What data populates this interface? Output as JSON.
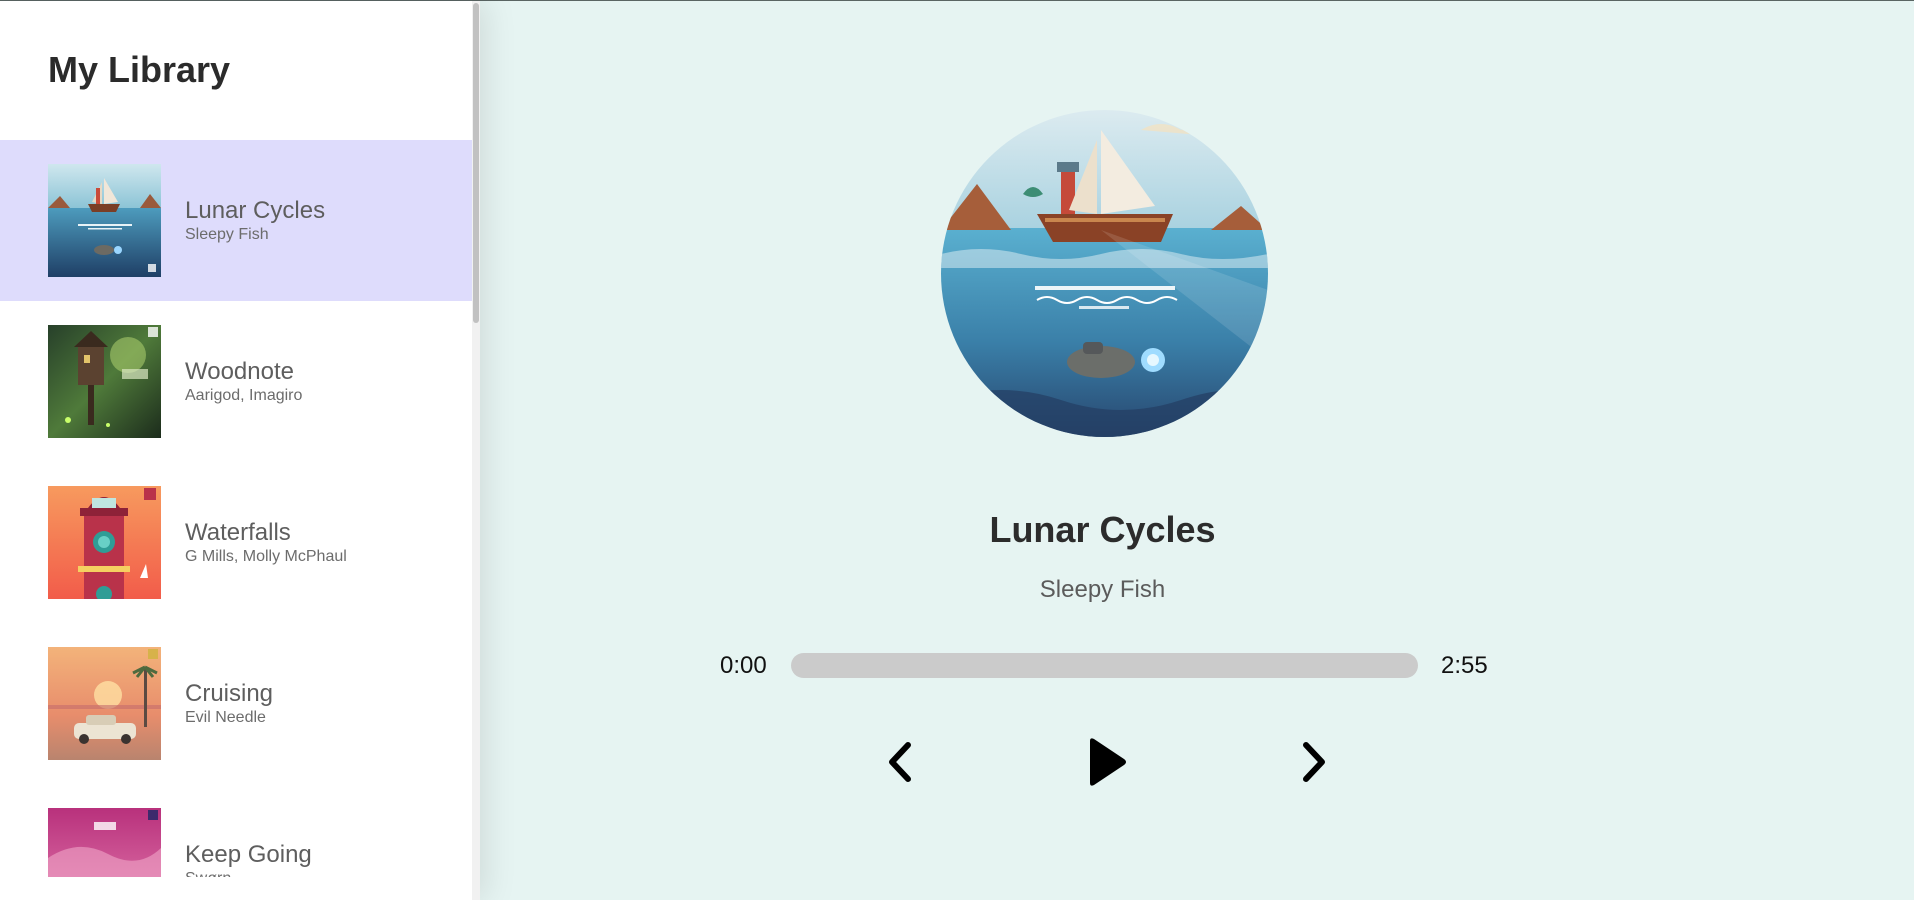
{
  "library": {
    "title": "My Library",
    "songs": [
      {
        "name": "Lunar Cycles",
        "artist": "Sleepy Fish",
        "active": true
      },
      {
        "name": "Woodnote",
        "artist": "Aarigod, Imagiro",
        "active": false
      },
      {
        "name": "Waterfalls",
        "artist": "G Mills, Molly McPhaul",
        "active": false
      },
      {
        "name": "Cruising",
        "artist": "Evil Needle",
        "active": false
      },
      {
        "name": "Keep Going",
        "artist": "Swørn",
        "active": false
      }
    ]
  },
  "player": {
    "title": "Lunar Cycles",
    "artist": "Sleepy Fish",
    "current_time": "0:00",
    "total_time": "2:55",
    "progress_fraction": 0
  },
  "icons": {
    "prev": "chevron-left-icon",
    "play": "play-icon",
    "next": "chevron-right-icon"
  },
  "colors": {
    "sidebar_bg": "#ffffff",
    "active_item_bg": "#dedcfc",
    "player_bg": "#e6f4f2",
    "progress_track": "#cbcbcb"
  }
}
